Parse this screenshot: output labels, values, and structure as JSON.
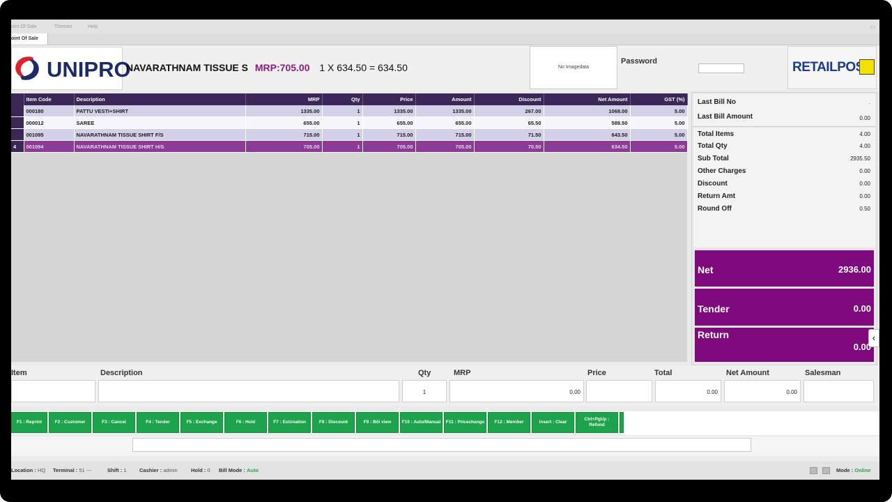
{
  "menubar": {
    "items": [
      "oint Of Sale",
      "Themes",
      "Help"
    ],
    "minimize": "▭"
  },
  "tab": {
    "label": "oint Of Sale"
  },
  "header": {
    "logo_text": "UNIPRO",
    "item_name": "NAVARATHNAM TISSUE S",
    "item_mrp": "MRP:705.00",
    "item_calc": "1  X 634.50 = 634.50",
    "image_placeholder": "No Imagedata",
    "password_label": "Password",
    "brand_text": "RETAILPOS"
  },
  "grid": {
    "columns": [
      "Item Code",
      "Description",
      "MRP",
      "Qty",
      "Price",
      "Amount",
      "Discount",
      "Net Amount",
      "GST (%)"
    ],
    "rows": [
      {
        "idx": "",
        "code": "000180",
        "desc": "PATTU VESTI+SHIRT",
        "mrp": "1335.00",
        "qty": "1",
        "price": "1335.00",
        "amount": "1335.00",
        "discount": "267.00",
        "net": "1068.00",
        "gst": "5.00"
      },
      {
        "idx": "",
        "code": "000012",
        "desc": "SAREE",
        "mrp": "655.00",
        "qty": "1",
        "price": "655.00",
        "amount": "655.00",
        "discount": "65.50",
        "net": "589.50",
        "gst": "5.00"
      },
      {
        "idx": "",
        "code": "001095",
        "desc": "NAVARATHNAM TISSUE SHIRT F/S",
        "mrp": "715.00",
        "qty": "1",
        "price": "715.00",
        "amount": "715.00",
        "discount": "71.50",
        "net": "643.50",
        "gst": "5.00"
      },
      {
        "idx": "4",
        "code": "001094",
        "desc": "NAVARATHNAM TISSUE SHIRT H/S",
        "mrp": "705.00",
        "qty": "1",
        "price": "705.00",
        "amount": "705.00",
        "discount": "70.50",
        "net": "634.50",
        "gst": "5.00"
      }
    ]
  },
  "summary": {
    "last_bill_no_label": "Last Bill No",
    "last_bill_no_value": ".",
    "last_bill_amount_label": "Last Bill Amount",
    "last_bill_amount_value": "0.00",
    "rows": [
      {
        "label": "Total Items",
        "value": "4.00"
      },
      {
        "label": "Total Qty",
        "value": "4.00"
      },
      {
        "label": "Sub Total",
        "value": "2935.50"
      },
      {
        "label": "Other Charges",
        "value": "0.00"
      },
      {
        "label": "Discount",
        "value": "0.00"
      },
      {
        "label": "Return Amt",
        "value": "0.00"
      },
      {
        "label": "Round Off",
        "value": "0.50"
      }
    ],
    "net_label": "Net",
    "net_value": "2936.00",
    "tender_label": "Tender",
    "tender_value": "0.00",
    "return_label": "Return",
    "return_value": "0.00",
    "collapse_icon": "‹"
  },
  "entry": {
    "labels": {
      "item": "Item",
      "description": "Description",
      "qty": "Qty",
      "mrp": "MRP",
      "price": "Price",
      "total": "Total",
      "net_amount": "Net Amount",
      "salesman": "Salesman"
    },
    "qty_value": "1",
    "mrp_value": "0.00",
    "total_value": "0.00",
    "net_amount_value": "0.00"
  },
  "fkeys": [
    "F1 : Reprint",
    "F2 : Customer",
    "F3 : Cancel",
    "F4 : Tender",
    "F5 : Exchange",
    "F6 : Hold",
    "F7 : Estimation",
    "F8 : Discount",
    "F9 : Bill view",
    "F10 : Auto/Manual",
    "F11 : Pricechange",
    "F12 : Member",
    "Insert : Clear",
    "Ctrl+PgUp : Refund"
  ],
  "status": {
    "location_label": "Location :",
    "location_value": "HQ",
    "terminal_label": "Terminal :",
    "terminal_value": "51 ---",
    "shift_label": "Shift :",
    "shift_value": "1",
    "cashier_label": "Cashier :",
    "cashier_value": "admin",
    "hold_label": "Hold :",
    "hold_value": "0",
    "billmode_label": "Bill Mode :",
    "billmode_value": "Auto",
    "mode_label": "Mode :",
    "mode_value": "Online"
  },
  "colors": {
    "header_purple": "#3b2757",
    "selected_row": "#8b3a96",
    "summary_purple": "#7e0a7e",
    "fkey_green": "#1da34b",
    "brand_blue": "#1d3a8a",
    "mrp_purple": "#8a1c7c"
  }
}
